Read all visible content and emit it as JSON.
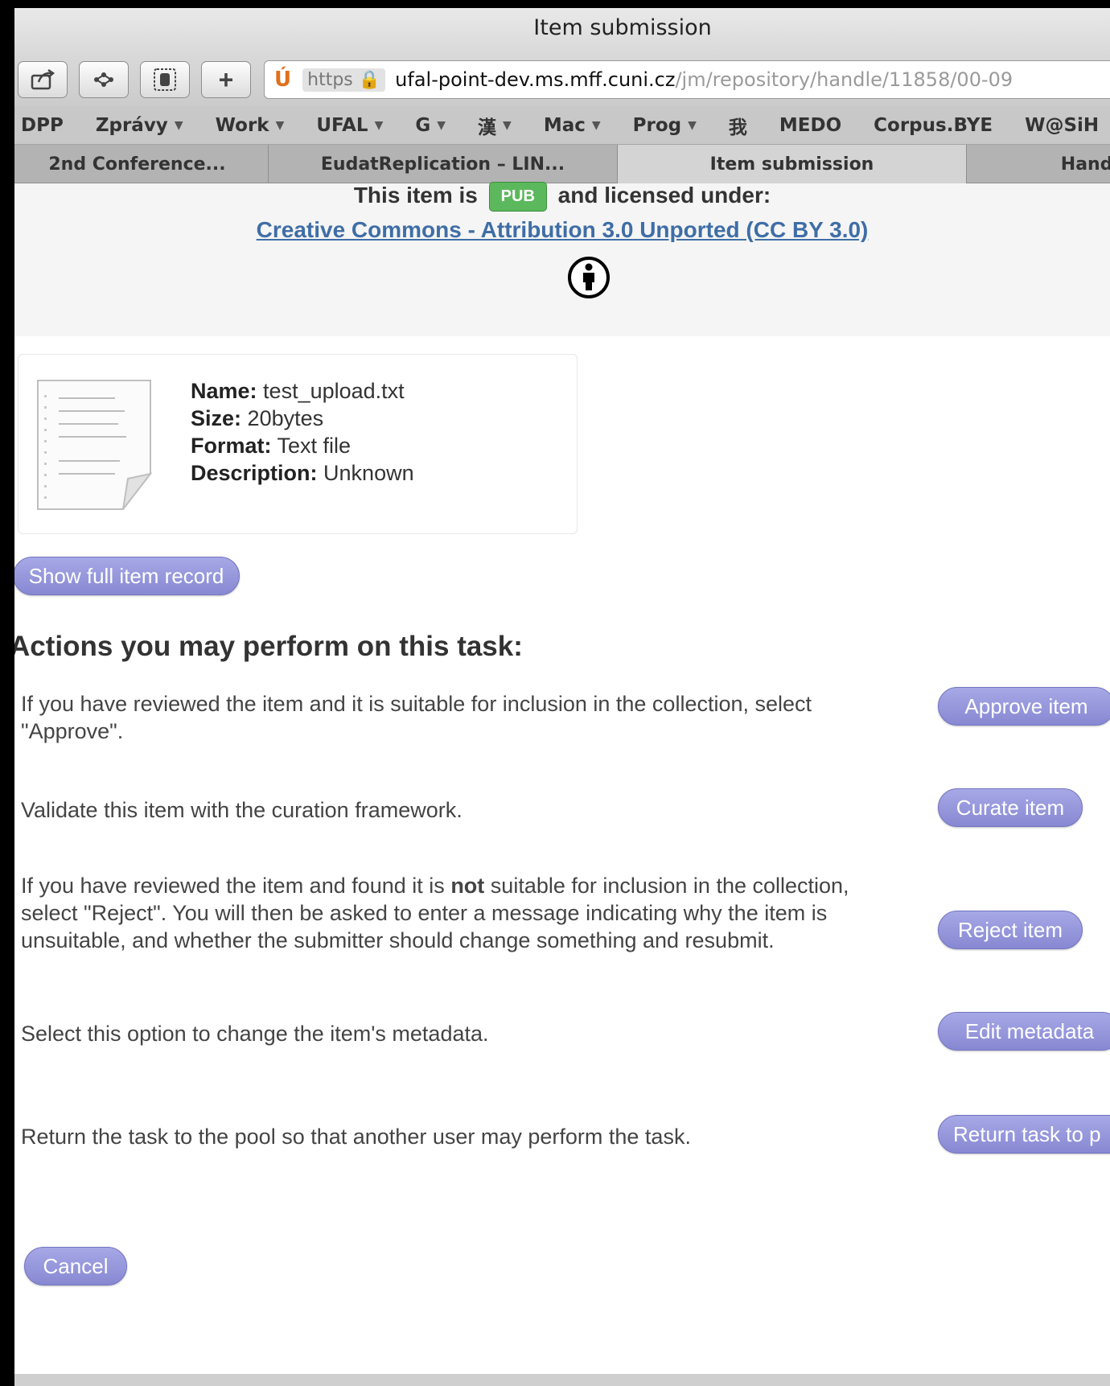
{
  "window": {
    "title": "Item submission"
  },
  "toolbar": {
    "url_scheme": "https",
    "url_host": "ufal-point-dev.ms.mff.cuni.cz",
    "url_path": "/jm/repository/handle/11858/00-09"
  },
  "bookmarks": [
    {
      "label": "DPP",
      "dropdown": false
    },
    {
      "label": "Zprávy",
      "dropdown": true
    },
    {
      "label": "Work",
      "dropdown": true
    },
    {
      "label": "UFAL",
      "dropdown": true
    },
    {
      "label": "G",
      "dropdown": true
    },
    {
      "label": "漢",
      "dropdown": true
    },
    {
      "label": "Mac",
      "dropdown": true
    },
    {
      "label": "Prog",
      "dropdown": true
    },
    {
      "label": "我",
      "dropdown": false
    },
    {
      "label": "MEDO",
      "dropdown": false
    },
    {
      "label": "Corpus.BYE",
      "dropdown": false
    },
    {
      "label": "W@SiH",
      "dropdown": false
    }
  ],
  "tabs": [
    {
      "label": "2nd Conference...",
      "active": false
    },
    {
      "label": "EudatReplication – LIN...",
      "active": false
    },
    {
      "label": "Item submission",
      "active": true
    },
    {
      "label": "Handl",
      "active": false
    }
  ],
  "license": {
    "prefix": "This item is",
    "badge": "PUB",
    "suffix": "and licensed under:",
    "link": "Creative Commons - Attribution 3.0 Unported (CC BY 3.0)"
  },
  "file": {
    "name_label": "Name:",
    "name": "test_upload.txt",
    "size_label": "Size:",
    "size": "20bytes",
    "format_label": "Format:",
    "format": "Text file",
    "description_label": "Description:",
    "description": "Unknown"
  },
  "buttons": {
    "show_full_record": "Show full item record",
    "approve": "Approve item",
    "curate": "Curate item",
    "reject": "Reject item",
    "edit_metadata": "Edit metadata",
    "return_task": "Return task to p",
    "cancel": "Cancel"
  },
  "actions": {
    "heading": "Actions you may perform on this task:",
    "approve_text": "If you have reviewed the item and it is suitable for inclusion in the collection, select \"Approve\".",
    "curate_text": "Validate this item with the curation framework.",
    "reject_text_before": "If you have reviewed the item and found it is ",
    "reject_text_bold": "not",
    "reject_text_after": " suitable for inclusion in the collection, select \"Reject\". You will then be asked to enter a message indicating why the item is unsuitable, and whether the submitter should change something and resubmit.",
    "edit_text": "Select this option to change the item's metadata.",
    "return_text": "Return the task to the pool so that another user may perform the task."
  }
}
